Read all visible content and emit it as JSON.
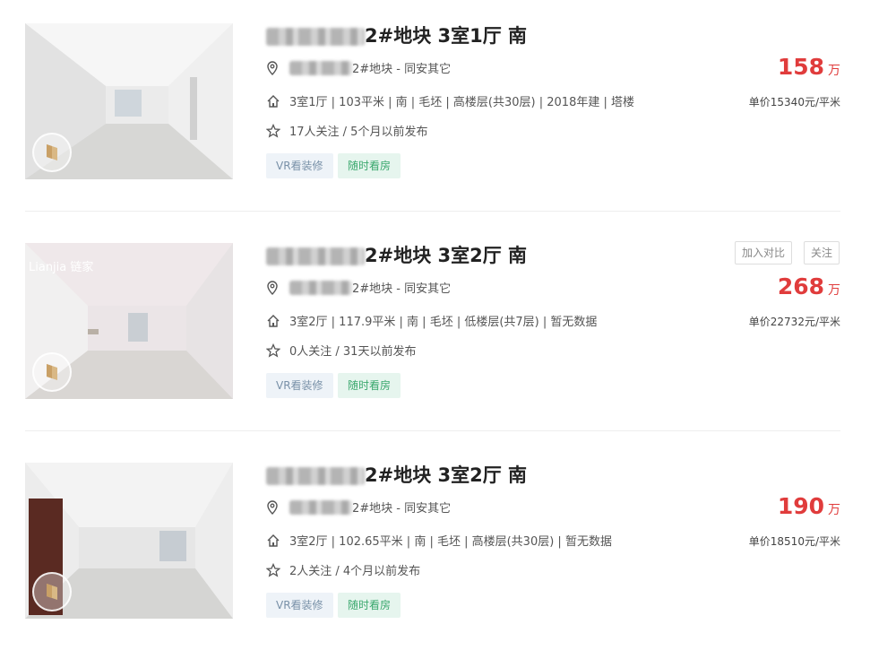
{
  "listings": [
    {
      "title": "2#地块 3室1厅 南",
      "location": "2#地块 - 同安其它",
      "info": "3室1厅 | 103平米 | 南 | 毛坯 | 高楼层(共30层) | 2018年建 | 塔楼",
      "follow": "17人关注 / 5个月以前发布",
      "tags": [
        "VR看装修",
        "随时看房"
      ],
      "price": "158",
      "price_unit": "万",
      "unit_price": "单价15340元/平米"
    },
    {
      "title": "2#地块 3室2厅 南",
      "location": "2#地块 - 同安其它",
      "info": "3室2厅 | 117.9平米 | 南 | 毛坯 | 低楼层(共7层) | 暂无数据",
      "follow": "0人关注 / 31天以前发布",
      "tags": [
        "VR看装修",
        "随时看房"
      ],
      "price": "268",
      "price_unit": "万",
      "unit_price": "单价22732元/平米",
      "actions": [
        "加入对比",
        "关注"
      ],
      "watermark": "Lianjia 链家"
    },
    {
      "title": "2#地块 3室2厅 南",
      "location": "2#地块 - 同安其它",
      "info": "3室2厅 | 102.65平米 | 南 | 毛坯 | 高楼层(共30层) | 暂无数据",
      "follow": "2人关注 / 4个月以前发布",
      "tags": [
        "VR看装修",
        "随时看房"
      ],
      "price": "190",
      "price_unit": "万",
      "unit_price": "单价18510元/平米"
    }
  ],
  "colors": {
    "price": "#e03c3c",
    "tag_vr_bg": "#eef3f8",
    "tag_vr_text": "#7991a8",
    "tag_see_bg": "#e6f5ee",
    "tag_see_text": "#3aa86d"
  },
  "icons": {
    "location": "location-pin-icon",
    "info": "house-icon",
    "follow": "star-icon",
    "vr": "vr-house-badge-icon"
  }
}
